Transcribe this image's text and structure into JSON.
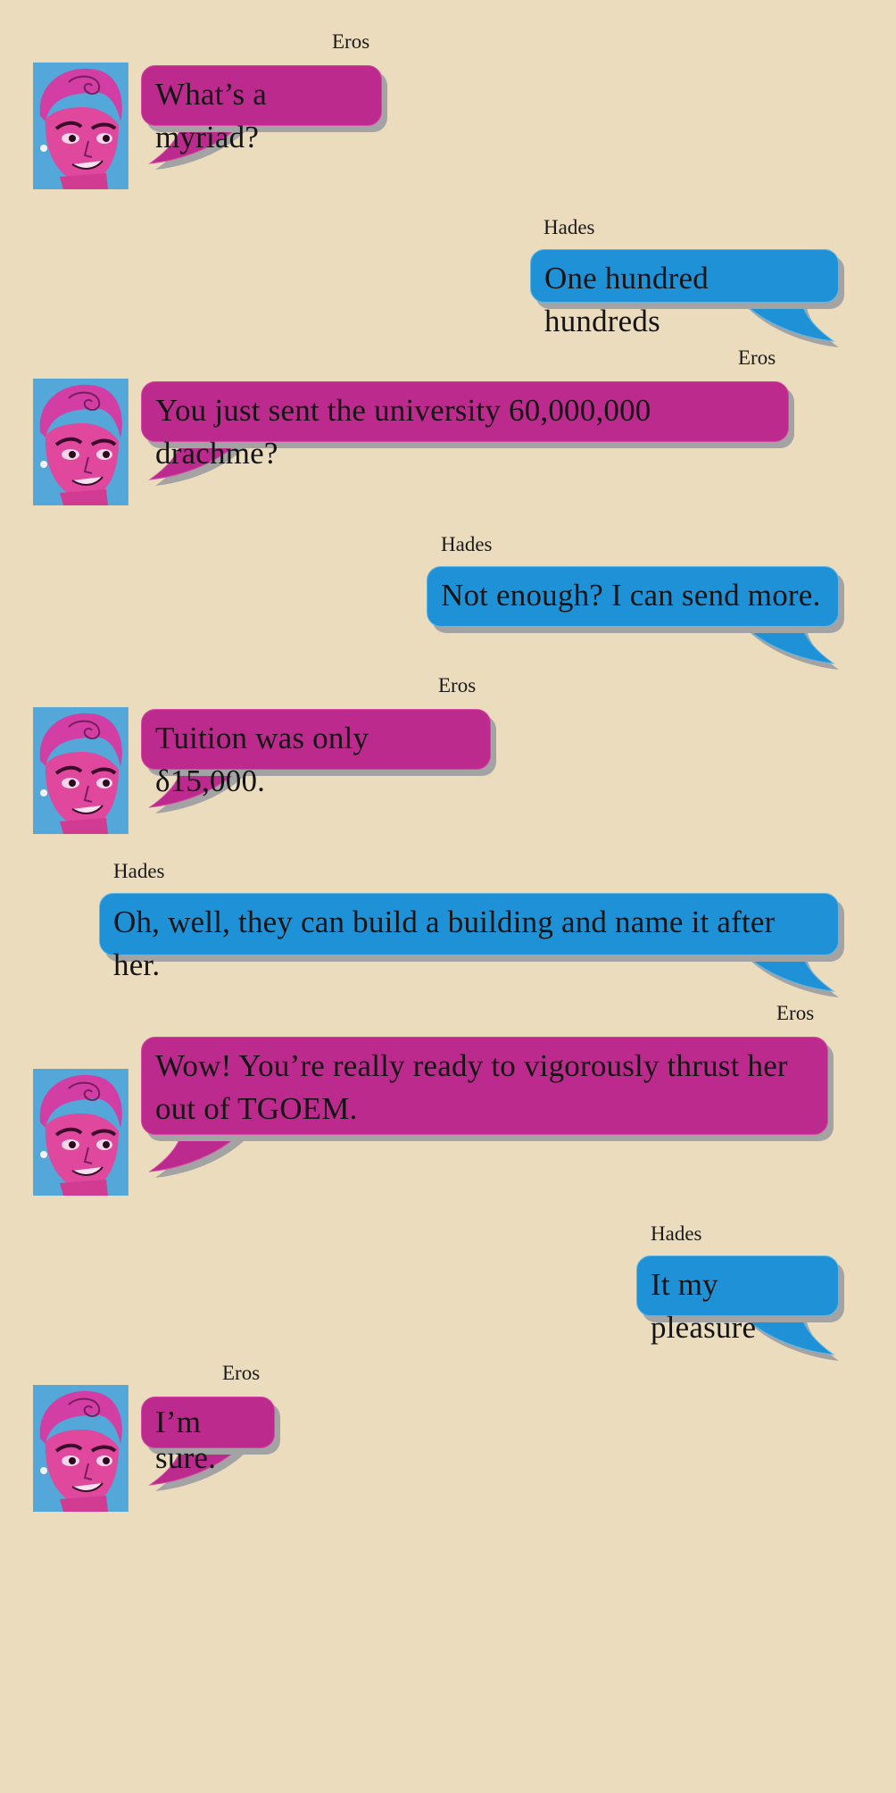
{
  "colors": {
    "background": "#ebdcbd",
    "eros_bubble": "#bb2a8c",
    "hades_bubble": "#1f91d6",
    "shadow": "#a3a3a3"
  },
  "messages": [
    {
      "speaker": "Eros",
      "text": "What’s a myriad?"
    },
    {
      "speaker": "Hades",
      "text": "One hundred hundreds"
    },
    {
      "speaker": "Eros",
      "text": "You just sent the university 60,000,000 drachme?"
    },
    {
      "speaker": "Hades",
      "text": "Not enough? I can send more."
    },
    {
      "speaker": "Eros",
      "text": "Tuition was only δ15,000."
    },
    {
      "speaker": "Hades",
      "text": "Oh, well, they can build a building and name it after her."
    },
    {
      "speaker": "Eros",
      "text": "Wow! You’re really ready to vigorously thrust her out of TGOEM."
    },
    {
      "speaker": "Hades",
      "text": "It my pleasure"
    },
    {
      "speaker": "Eros",
      "text": "I’m sure."
    }
  ],
  "avatar_icon": "eros-portrait-avatar"
}
